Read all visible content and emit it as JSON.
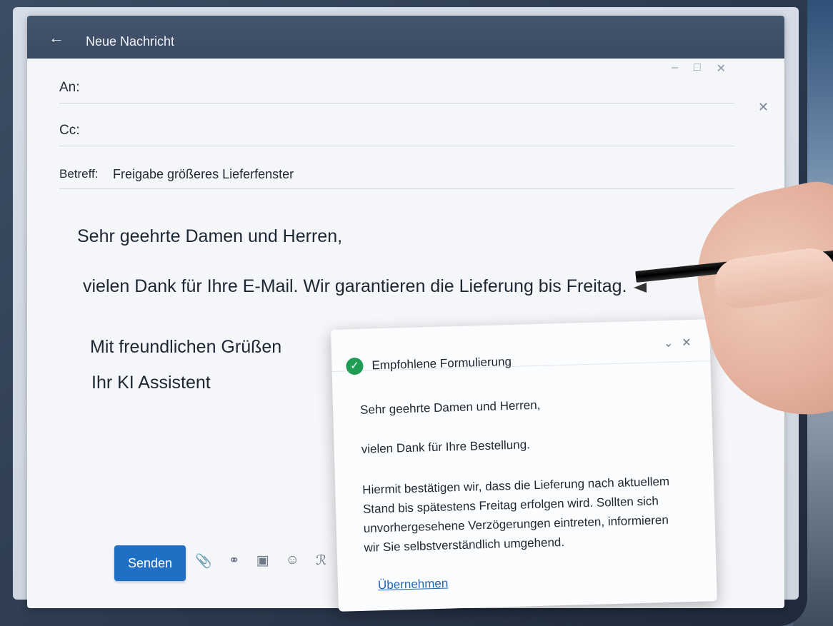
{
  "window": {
    "title": "Neue Nachricht"
  },
  "fields": {
    "to_label": "An:",
    "cc_label": "Cc:",
    "subject_label": "Betreff:",
    "subject_value": "Freigabe größeres Lieferfenster"
  },
  "body": {
    "greeting": "Sehr geehrte Damen und Herren,",
    "line1": "vielen Dank für Ihre E-Mail. Wir garantieren die Lieferung bis Freitag.",
    "closing": "Mit freundlichen Grüßen",
    "signature": "Ihr KI Assistent"
  },
  "toolbar": {
    "send_label": "Senden"
  },
  "suggestion": {
    "title": "Empfohlene Formulierung",
    "greeting": "Sehr geehrte Damen und Herren,",
    "line1": "vielen Dank für Ihre Bestellung.",
    "para_l1": "Hiermit bestätigen wir, dass die Lieferung nach aktuellem",
    "para_l2": "Stand bis spätestens Freitag erfolgen wird. Sollten sich",
    "para_l3": "unvorhergesehene Verzögerungen eintreten, informieren",
    "para_l4": "wir Sie selbstverständlich umgehend.",
    "apply_label": "Übernehmen"
  },
  "colors": {
    "send_button": "#1f6fc4",
    "check": "#1f9d55",
    "titlebar": "#3a4a62",
    "link": "#1f66b3"
  }
}
